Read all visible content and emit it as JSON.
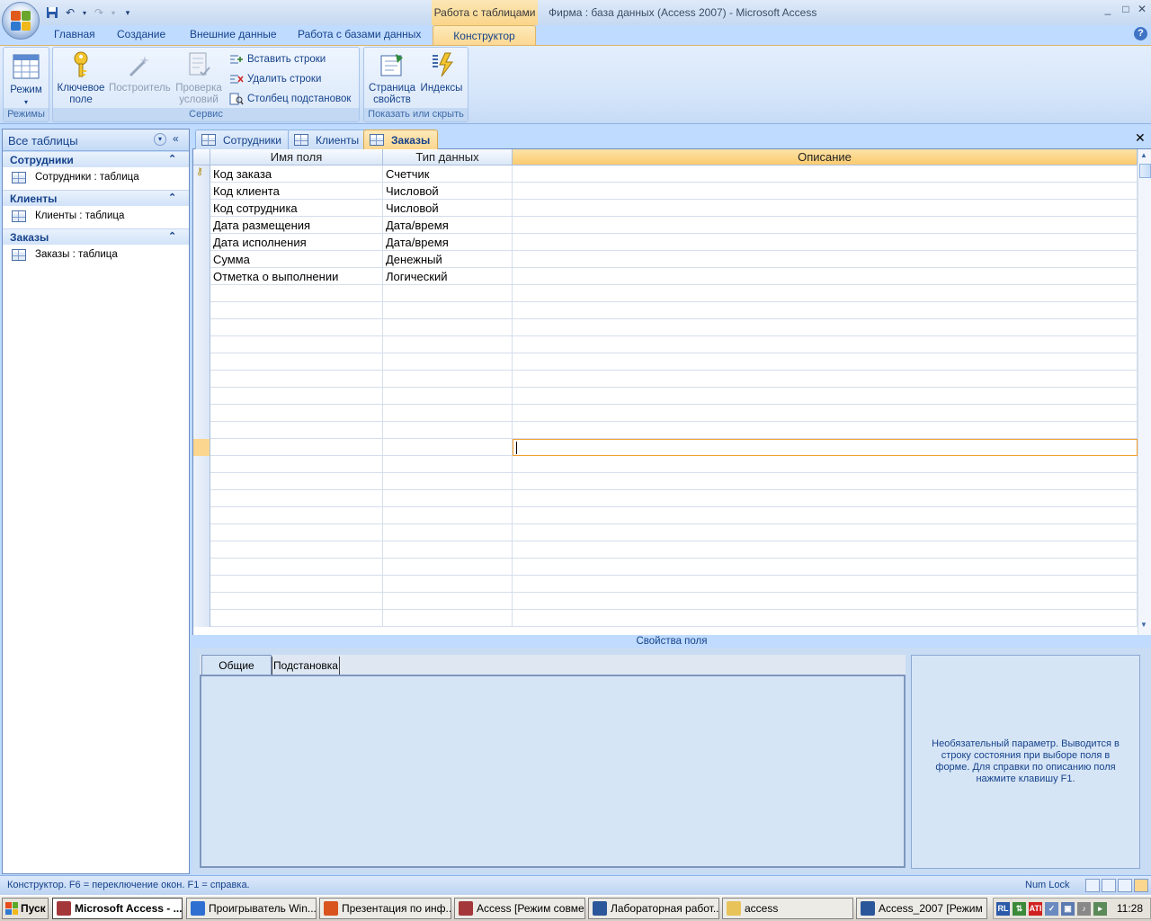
{
  "window": {
    "context_tab": "Работа с таблицами",
    "title": "Фирма : база данных (Access 2007) - Microsoft Access",
    "controls": [
      "_",
      "□",
      "✕"
    ]
  },
  "quick_access": {
    "icons": [
      "save-icon",
      "undo-icon",
      "redo-icon",
      "customize-icon"
    ]
  },
  "ribbon": {
    "tabs": [
      "Главная",
      "Создание",
      "Внешние данные",
      "Работа с базами данных"
    ],
    "active_tab": "Конструктор",
    "groups": {
      "modes": {
        "label": "Режимы",
        "view_button": "Режим"
      },
      "service": {
        "label": "Сервис",
        "key_field_1": "Ключевое",
        "key_field_2": "поле",
        "builder": "Построитель",
        "validation_1": "Проверка",
        "validation_2": "условий",
        "insert_rows": "Вставить строки",
        "delete_rows": "Удалить строки",
        "lookup_column": "Столбец  подстановок"
      },
      "show_hide": {
        "label": "Показать или скрыть",
        "property_sheet_1": "Страница",
        "property_sheet_2": "свойств",
        "indexes": "Индексы"
      }
    }
  },
  "nav_pane": {
    "title": "Все таблицы",
    "groups": [
      {
        "name": "Сотрудники",
        "item": "Сотрудники : таблица"
      },
      {
        "name": "Клиенты",
        "item": "Клиенты : таблица"
      },
      {
        "name": "Заказы",
        "item": "Заказы : таблица"
      }
    ]
  },
  "document_tabs": {
    "tabs": [
      "Сотрудники",
      "Клиенты",
      "Заказы"
    ],
    "active": "Заказы"
  },
  "design_grid": {
    "columns": [
      "Имя поля",
      "Тип данных",
      "Описание"
    ],
    "rows": [
      {
        "field": "Код заказа",
        "type": "Счетчик",
        "primary_key": true
      },
      {
        "field": "Код клиента",
        "type": "Числовой"
      },
      {
        "field": "Код сотрудника",
        "type": "Числовой"
      },
      {
        "field": "Дата размещения",
        "type": "Дата/время"
      },
      {
        "field": "Дата исполнения",
        "type": "Дата/время"
      },
      {
        "field": "Сумма",
        "type": "Денежный"
      },
      {
        "field": "Отметка о выполнении",
        "type": "Логический"
      }
    ],
    "selected_row": 16
  },
  "field_properties": {
    "title": "Свойства поля",
    "tabs": [
      "Общие",
      "Подстановка"
    ],
    "hint": "Необязательный параметр.  Выводится в строку состояния при выборе поля в форме.  Для справки по описанию поля нажмите клавишу F1."
  },
  "status_bar": {
    "text": "Конструктор.  F6 = переключение окон.  F1 = справка.",
    "numlock": "Num Lock"
  },
  "taskbar": {
    "start": "Пуск",
    "buttons": [
      {
        "label": "Microsoft Access - ...",
        "color": "#a4373a"
      },
      {
        "label": "Проигрыватель Win...",
        "color": "#2f6fd1"
      },
      {
        "label": "Презентация по инф...",
        "color": "#d9531e"
      },
      {
        "label": "Access [Режим совме...",
        "color": "#a4373a"
      },
      {
        "label": "Лабораторная работ...",
        "color": "#2b579a"
      },
      {
        "label": "access",
        "color": "#e8c35a"
      },
      {
        "label": "Access_2007 [Режим ...",
        "color": "#2b579a"
      }
    ],
    "tray": [
      "RL",
      "ATI"
    ],
    "clock": "11:28"
  }
}
